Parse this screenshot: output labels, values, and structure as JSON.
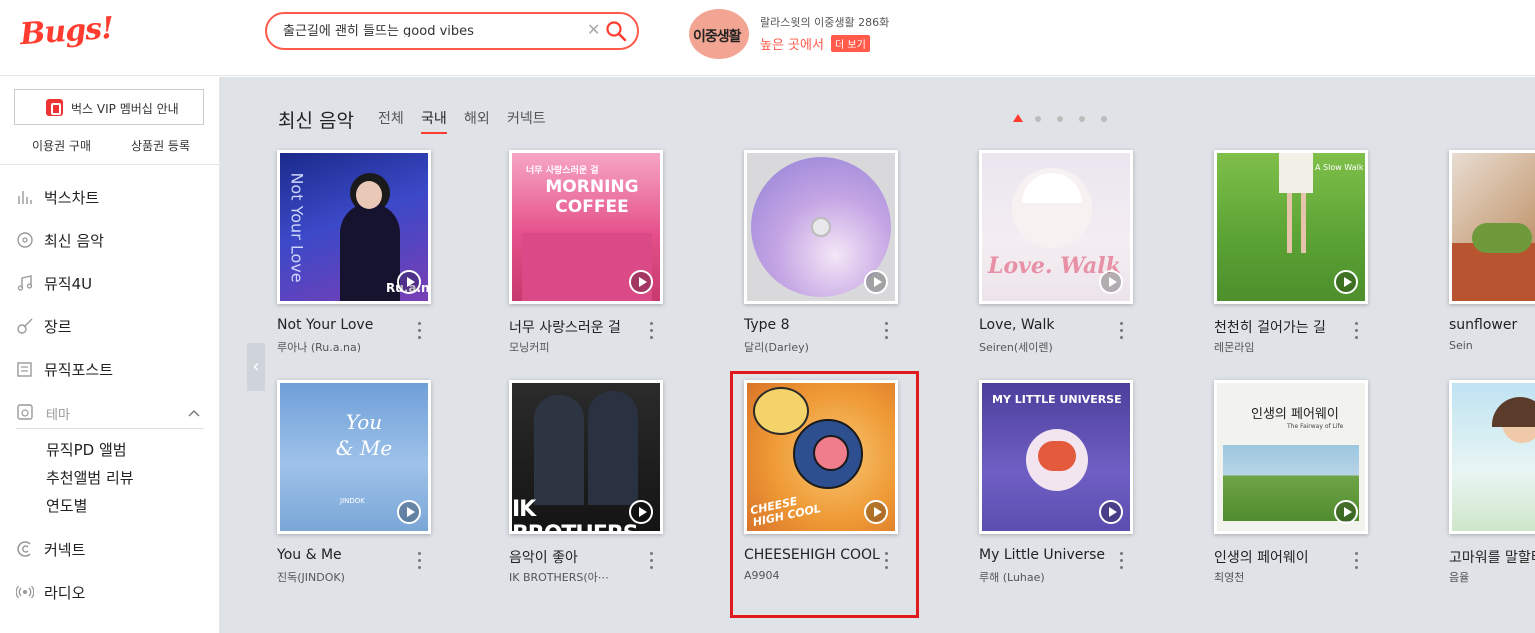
{
  "header": {
    "logo": "Bugs!",
    "search": {
      "value": "출근길에 괜히 들뜨는 good vibes",
      "clear": "✕"
    },
    "promo": {
      "thumb_text": "이중생활",
      "subtitle": "랄라스윗의 이중생활 286화",
      "title": "높은 곳에서",
      "more": "더 보기"
    }
  },
  "sidebar": {
    "vip_label": "벅스 VIP 멤버십 안내",
    "links": [
      "이용권 구매",
      "상품권 등록"
    ],
    "nav": [
      {
        "label": "벅스차트",
        "icon": "chart-icon"
      },
      {
        "label": "최신 음악",
        "icon": "new-music-icon"
      },
      {
        "label": "뮤직4U",
        "icon": "music-note-icon"
      },
      {
        "label": "장르",
        "icon": "guitar-icon"
      },
      {
        "label": "뮤직포스트",
        "icon": "post-icon"
      }
    ],
    "theme": {
      "label": "테마",
      "items": [
        "뮤직PD 앨범",
        "추천앨범 리뷰",
        "연도별"
      ]
    },
    "nav2": [
      {
        "label": "커넥트",
        "icon": "connect-icon"
      },
      {
        "label": "라디오",
        "icon": "radio-icon"
      }
    ]
  },
  "main": {
    "section_title": "최신 음악",
    "tabs": [
      "전체",
      "국내",
      "해외",
      "커넥트"
    ],
    "active_tab": "국내",
    "albums": [
      {
        "title": "Not Your Love",
        "artist": "루아나 (Ru.a.na)",
        "cover_text": "Ru.a.na",
        "side_text": "Not Your Love"
      },
      {
        "title": "너무 사랑스러운 걸",
        "artist": "모닝커피",
        "cover_text": "MORNING COFFEE",
        "cover_sub": "너무 사랑스러운 걸"
      },
      {
        "title": "Type 8",
        "artist": "달리(Darley)"
      },
      {
        "title": "Love, Walk",
        "artist": "Seiren(세이렌)",
        "cover_text": "Love. Walk"
      },
      {
        "title": "천천히 걸어가는 길",
        "artist": "레몬라임",
        "cover_text": "A Slow Walk"
      },
      {
        "title": "sunflower",
        "artist": "Sein"
      },
      {
        "title": "You & Me",
        "artist": "진독(JINDOK)",
        "cover_text": "You & Me",
        "cover_sub": "JINDOK"
      },
      {
        "title": "음악이 좋아",
        "artist": "IK BROTHERS(아⋯",
        "cover_text": "IK BROTHERS"
      },
      {
        "title": "CHEESEHIGH COOL",
        "artist": "A9904",
        "cover_text": "CHEESE HIGH COOL"
      },
      {
        "title": "My Little Universe",
        "artist": "루해 (Luhae)",
        "cover_text": "MY LITTLE UNIVERSE"
      },
      {
        "title": "인생의 페어웨이",
        "artist": "최영천",
        "cover_text": "인생의 페어웨이",
        "cover_sub": "The Fairway of Life"
      },
      {
        "title": "고마워를 말할티",
        "artist": "음율"
      }
    ]
  },
  "colors": {
    "brand": "#ff3c2f",
    "highlight": "#e0191f",
    "main_bg": "#dfe3e8"
  }
}
